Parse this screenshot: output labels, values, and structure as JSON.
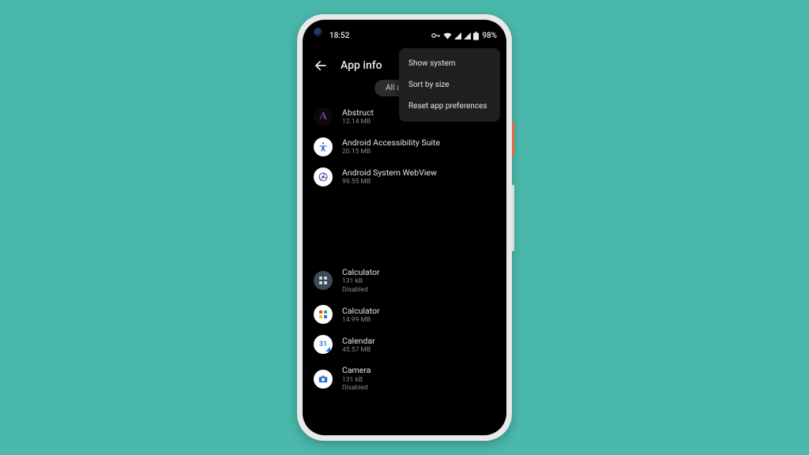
{
  "status": {
    "time": "18:52",
    "battery": "98%"
  },
  "header": {
    "title": "App info"
  },
  "filter": {
    "label": "All apps"
  },
  "menu": {
    "items": [
      {
        "label": "Show system"
      },
      {
        "label": "Sort by size"
      },
      {
        "label": "Reset app preferences"
      }
    ]
  },
  "apps": [
    {
      "name": "Abstruct",
      "size": "12.14 MB",
      "status": ""
    },
    {
      "name": "Android Accessibility Suite",
      "size": "20.15 MB",
      "status": ""
    },
    {
      "name": "Android System WebView",
      "size": "99.55 MB",
      "status": ""
    },
    {
      "name": "Calculator",
      "size": "131 kB",
      "status": "Disabled"
    },
    {
      "name": "Calculator",
      "size": "14.99 MB",
      "status": ""
    },
    {
      "name": "Calendar",
      "size": "45.57 MB",
      "status": ""
    },
    {
      "name": "Camera",
      "size": "131 kB",
      "status": "Disabled"
    }
  ]
}
